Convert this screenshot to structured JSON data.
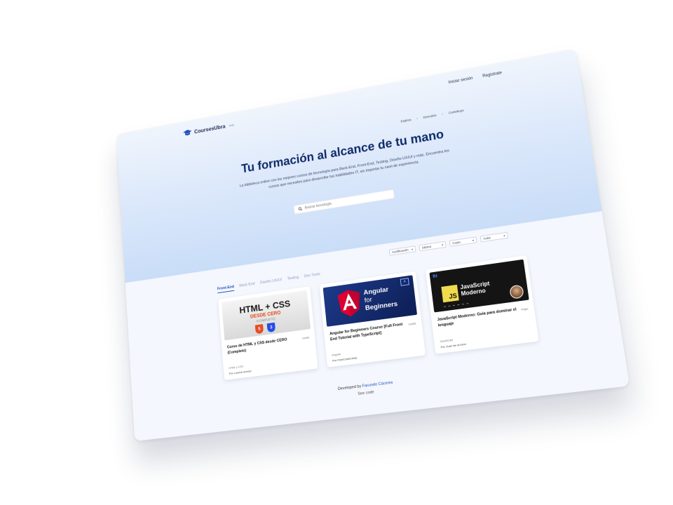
{
  "nav": {
    "logo_text": "CoursesUbra",
    "logo_tag": "beta",
    "login": "Iniciar sesión",
    "register": "Registrate"
  },
  "breadcrumb": [
    "Explora",
    "Descubre",
    "Contribuye"
  ],
  "hero": {
    "title": "Tu formación al alcance de tu mano",
    "description": "La biblioteca online con los mejores cursos de tecnología para Back-End, Front-End, Testing, Diseño UX/UI y más. Encuentra los cursos que necesites para desarrollar tus habilidades IT, sin importar tu nivel de experiencia.",
    "search_placeholder": "Buscar tecnología"
  },
  "tabs": [
    "Front-End",
    "Back-End",
    "Diseño UX/UI",
    "Testing",
    "Dev Tools"
  ],
  "filters": [
    "Certificación",
    "Idioma",
    "Costo",
    "Autor"
  ],
  "cards": [
    {
      "title": "Curso de HTML y CSS desde CERO (Completo)",
      "price": "Gratis",
      "meta": "HTML y CSS",
      "author": "Por Lorena Gomez",
      "thumb": {
        "line1": "HTML + CSS",
        "line2": "DESDE CERO",
        "line3": "(COMPLETO)",
        "icon1": "5",
        "icon2": "3"
      }
    },
    {
      "title": "Angular for Beginners Course [Full Front End Tutorial with TypeScript]",
      "price": "Gratis",
      "meta": "Angular",
      "author": "Por FreeCodeCamp",
      "thumb": {
        "line1": "Angular",
        "line2": "for",
        "line3": "Beginners",
        "corner": "A"
      }
    },
    {
      "title": "JavaScript Moderno: Guía para dominar el lenguaje",
      "price": "Pago",
      "meta": "JavaScript",
      "author": "Por Juan de la torre",
      "thumb": {
        "logo": "JS",
        "line1": "JavaScript",
        "line2": "Moderno",
        "badge": "fH",
        "wave": "~ ~ ~ ~ ~ ~"
      }
    }
  ],
  "footer": {
    "developed_by": "Developed by",
    "name": "Facundo Cáceres",
    "code": "See code"
  },
  "colors": {
    "accent": "#1d4fbf",
    "title": "#0f2a68",
    "html5": "#e44d26",
    "css3": "#264de4",
    "angular": "#dd0031",
    "js": "#f0db4f"
  }
}
